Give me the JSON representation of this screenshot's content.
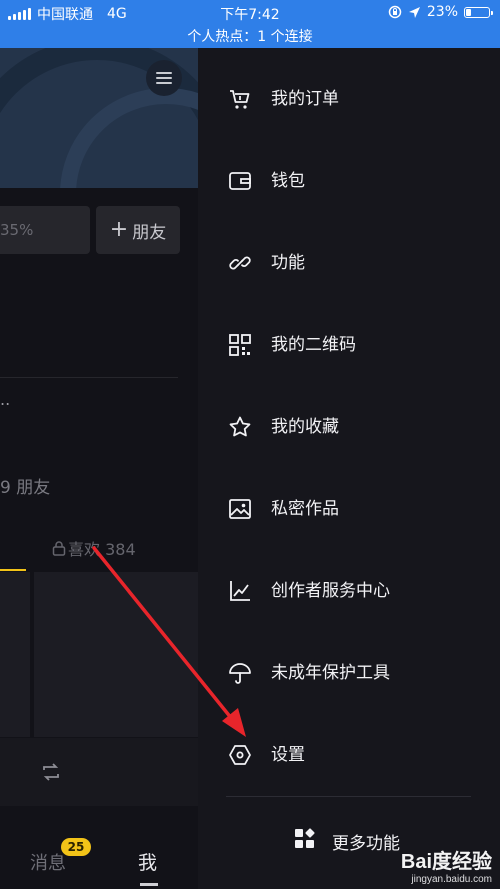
{
  "status_bar": {
    "carrier": "中国联通",
    "network": "4G",
    "time": "下午7:42",
    "battery": "23%",
    "battery_level": 0.23,
    "hotspot": "个人热点：1 个连接"
  },
  "profile": {
    "stat_text": "35%",
    "add_friend_label": "朋友",
    "ellipsis": "..",
    "friends_text": "9 朋友",
    "likes_label": "喜欢 384",
    "messages_tab": "消息",
    "messages_badge": "25",
    "me_tab": "我"
  },
  "drawer": {
    "items": [
      {
        "label": "我的订单",
        "icon": "cart-icon"
      },
      {
        "label": "钱包",
        "icon": "wallet-icon"
      },
      {
        "label": "功能",
        "icon": "link-icon"
      },
      {
        "label": "我的二维码",
        "icon": "qr-code-icon"
      },
      {
        "label": "我的收藏",
        "icon": "star-icon"
      },
      {
        "label": "私密作品",
        "icon": "image-icon"
      },
      {
        "label": "创作者服务中心",
        "icon": "chart-icon"
      },
      {
        "label": "未成年保护工具",
        "icon": "umbrella-icon"
      },
      {
        "label": "设置",
        "icon": "hexagon-icon"
      }
    ],
    "more_label": "更多功能"
  },
  "watermark": {
    "logo": "Bai度经验",
    "url": "jingyan.baidu.com"
  },
  "colors": {
    "status_bar": "#2f7fe8",
    "drawer_bg": "#16161c",
    "accent_yellow": "#f2c318",
    "arrow": "#e8252b"
  }
}
